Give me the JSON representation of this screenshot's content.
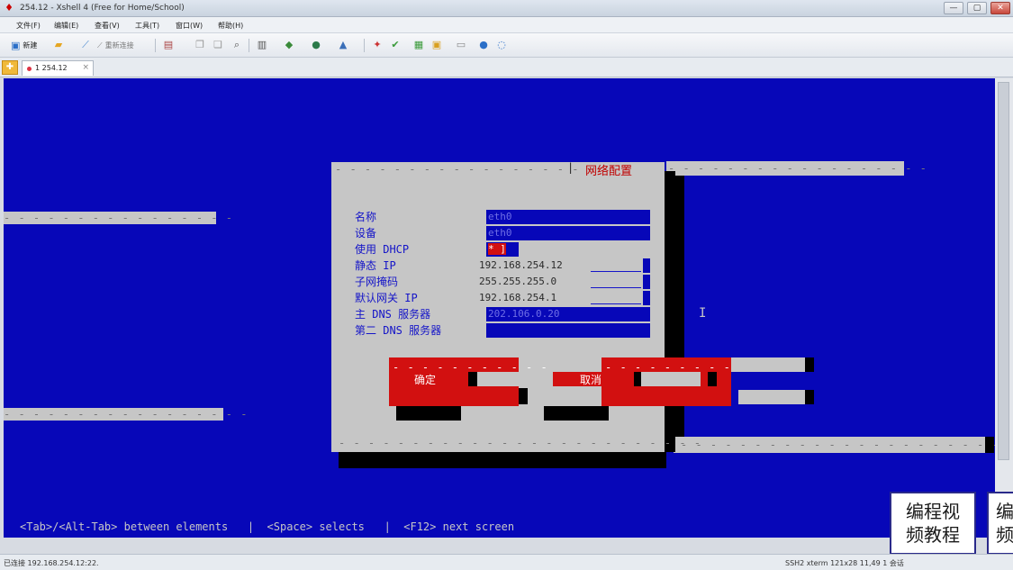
{
  "window": {
    "title": "254.12 - Xshell 4 (Free for Home/School)",
    "buttons": {
      "minimize": "—",
      "maximize": "▢",
      "close": "✕"
    }
  },
  "menu": [
    "文件(F)",
    "编辑(E)",
    "查看(V)",
    "工具(T)",
    "窗口(W)",
    "帮助(H)"
  ],
  "toolbar": {
    "new_session": "新建",
    "reconnect": "重新连接"
  },
  "tab": {
    "label": "1 254.12"
  },
  "dialog": {
    "title": "网络配置",
    "fields": [
      {
        "label": "名称",
        "value": "eth0"
      },
      {
        "label": "设备",
        "value": "eth0"
      },
      {
        "label": "使用 DHCP",
        "value": "* ]"
      },
      {
        "label": "静态 IP",
        "value": "192.168.254.12"
      },
      {
        "label": "子网掩码",
        "value": "255.255.255.0"
      },
      {
        "label": "默认网关 IP",
        "value": "192.168.254.1"
      },
      {
        "label": "主 DNS 服务器",
        "value": "202.106.0.20"
      },
      {
        "label": "第二 DNS 服务器",
        "value": ""
      }
    ],
    "ok_button": "确定",
    "cancel_button": "取消"
  },
  "hint_line": "<Tab>/<Alt-Tab> between elements   |  <Space> selects   |  <F12> next screen",
  "watermark": {
    "line1": "编程视",
    "line2": "频教程"
  },
  "status": {
    "left": "已连接 192.168.254.12:22.",
    "right": "SSH2   xterm   121x28   11,49   1 会话"
  },
  "colors": {
    "terminal_bg": "#0707b8",
    "dialog_bg": "#c6c6c6",
    "accent_red": "#d21010"
  }
}
